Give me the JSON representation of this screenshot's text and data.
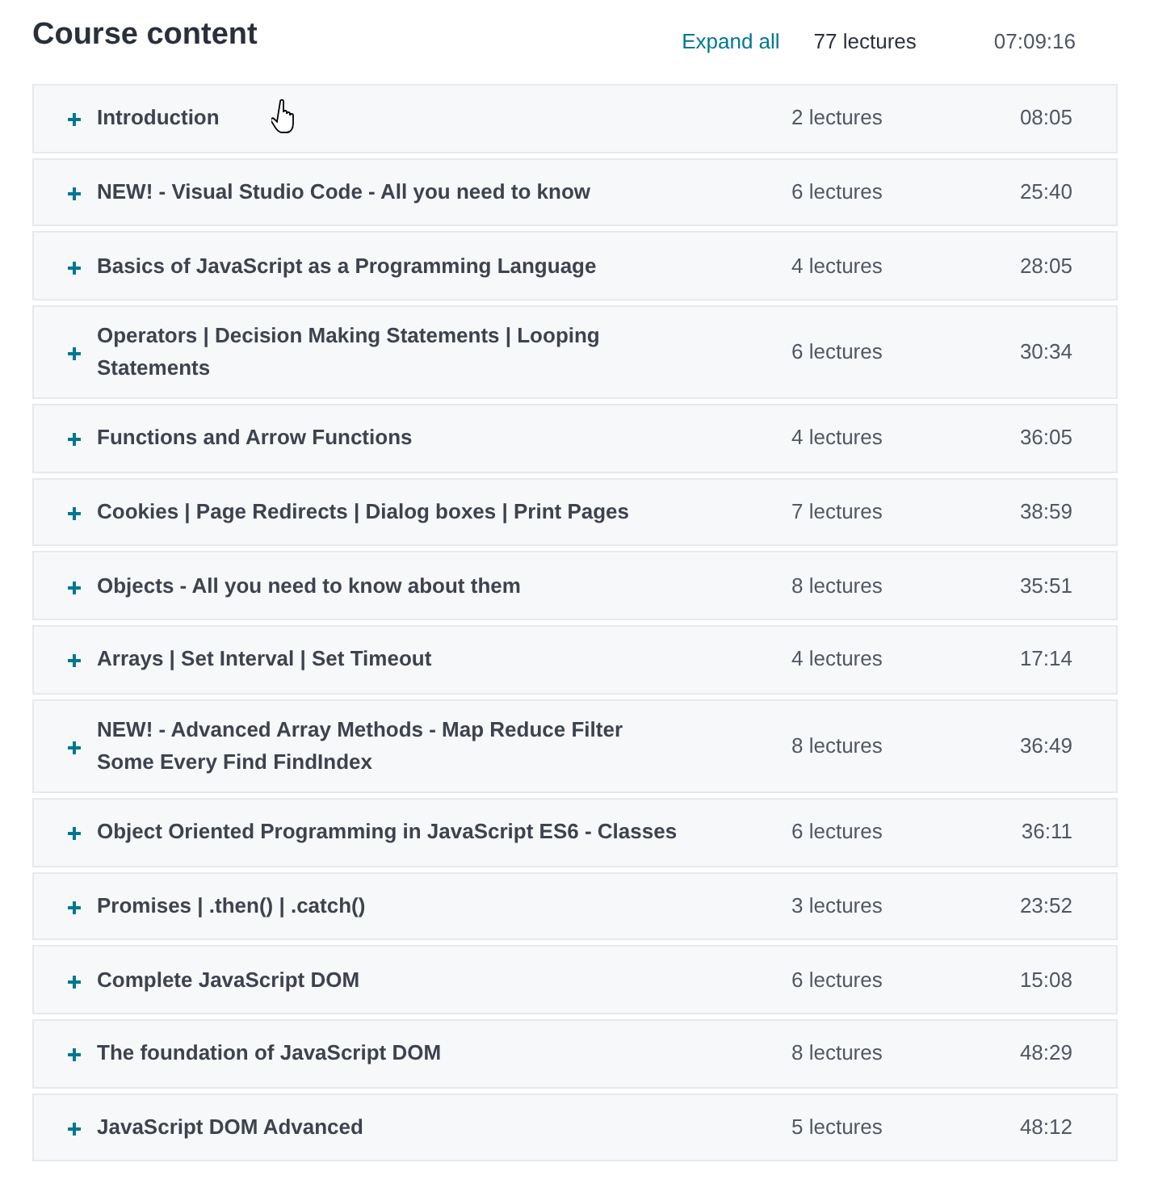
{
  "header": {
    "title": "Course content",
    "expand_all": "Expand all",
    "lectures": "77 lectures",
    "duration": "07:09:16"
  },
  "sections": [
    {
      "title": "Introduction",
      "lectures": "2 lectures",
      "duration": "08:05",
      "expanded": false
    },
    {
      "title": "NEW! - Visual Studio Code - All you need to know",
      "lectures": "6 lectures",
      "duration": "25:40",
      "expanded": false
    },
    {
      "title": "Basics of JavaScript as a Programming Language",
      "lectures": "4 lectures",
      "duration": "28:05",
      "expanded": false
    },
    {
      "title": "Operators | Decision Making Statements | Looping Statements",
      "lectures": "6 lectures",
      "duration": "30:34",
      "expanded": false
    },
    {
      "title": "Functions and Arrow Functions",
      "lectures": "4 lectures",
      "duration": "36:05",
      "expanded": false
    },
    {
      "title": "Cookies | Page Redirects | Dialog boxes | Print Pages",
      "lectures": "7 lectures",
      "duration": "38:59",
      "expanded": false
    },
    {
      "title": "Objects - All you need to know about them",
      "lectures": "8 lectures",
      "duration": "35:51",
      "expanded": false
    },
    {
      "title": "Arrays | Set Interval | Set Timeout",
      "lectures": "4 lectures",
      "duration": "17:14",
      "expanded": false
    },
    {
      "title": "NEW! - Advanced Array Methods - Map Reduce Filter Some Every Find FindIndex",
      "lectures": "8 lectures",
      "duration": "36:49",
      "expanded": false
    },
    {
      "title": "Object Oriented Programming in JavaScript ES6 - Classes",
      "lectures": "6 lectures",
      "duration": "36:11",
      "expanded": false
    },
    {
      "title": "Promises | .then() | .catch()",
      "lectures": "3 lectures",
      "duration": "23:52",
      "expanded": false
    },
    {
      "title": "Complete JavaScript DOM",
      "lectures": "6 lectures",
      "duration": "15:08",
      "expanded": false
    },
    {
      "title": "The foundation of JavaScript DOM",
      "lectures": "8 lectures",
      "duration": "48:29",
      "expanded": false
    },
    {
      "title": "JavaScript DOM Advanced",
      "lectures": "5 lectures",
      "duration": "48:12",
      "expanded": false
    }
  ]
}
